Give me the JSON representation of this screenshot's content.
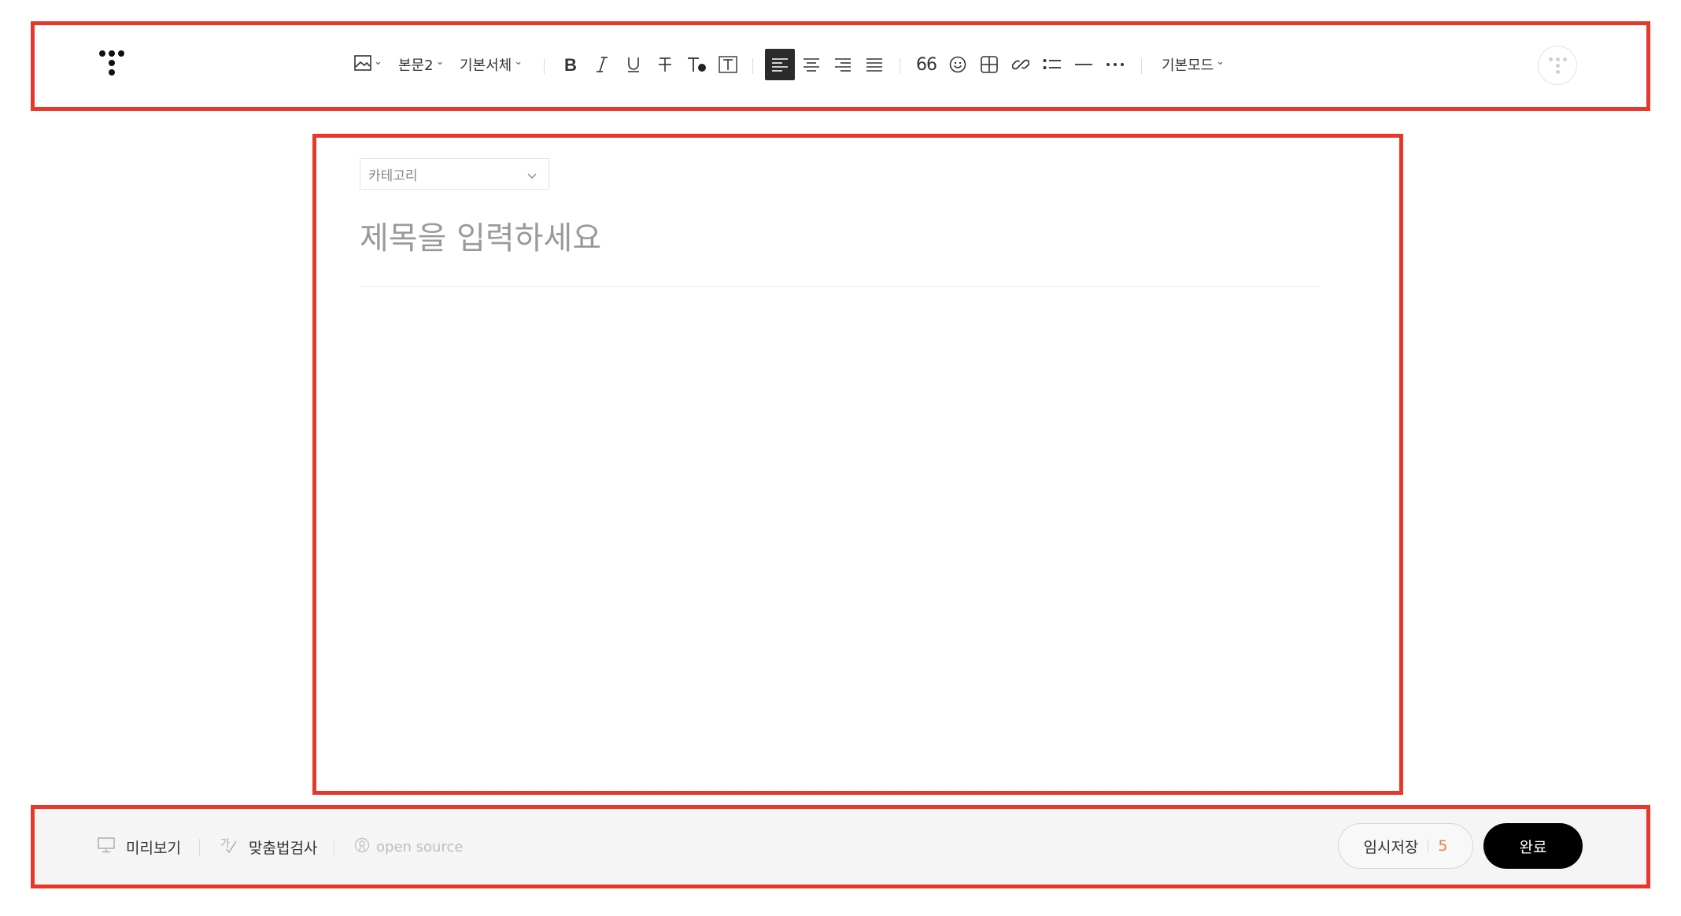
{
  "toolbar": {
    "paragraph_style": "본문2",
    "font_family": "기본서체",
    "mode": "기본모드",
    "quote_glyph": "66",
    "icons": [
      "image-icon",
      "bold-icon",
      "italic-icon",
      "underline-icon",
      "strikethrough-icon",
      "text-color-icon",
      "text-background-icon",
      "align-left-icon",
      "align-center-icon",
      "align-right-icon",
      "align-justify-icon",
      "quote-icon",
      "emoji-icon",
      "table-icon",
      "link-icon",
      "list-icon",
      "divider-icon",
      "more-icon"
    ],
    "active_alignment": "left"
  },
  "editor": {
    "category_placeholder": "카테고리",
    "title_placeholder": "제목을 입력하세요"
  },
  "bottom": {
    "preview_label": "미리보기",
    "spellcheck_label": "맞춤법검사",
    "open_source_label": "open source",
    "save_label": "임시저장",
    "save_count": "5",
    "done_label": "완료"
  },
  "colors": {
    "frame": "#e8382c",
    "accent_count": "#f07e3c",
    "done_bg": "#000000"
  }
}
